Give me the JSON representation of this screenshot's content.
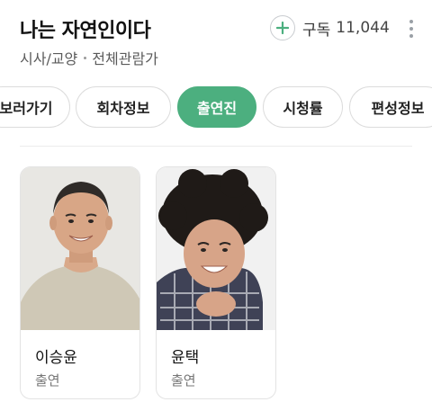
{
  "program": {
    "title": "나는 자연인이다",
    "genre": "시사/교양",
    "rating": "전체관람가"
  },
  "subscribe": {
    "label": "구독",
    "count": "11,044"
  },
  "tabs": [
    {
      "label": "보러가기",
      "active": false
    },
    {
      "label": "회차정보",
      "active": false
    },
    {
      "label": "출연진",
      "active": true
    },
    {
      "label": "시청률",
      "active": false
    },
    {
      "label": "편성정보",
      "active": false
    }
  ],
  "cast": [
    {
      "name": "이승윤",
      "role": "출연"
    },
    {
      "name": "윤택",
      "role": "출연"
    }
  ],
  "colors": {
    "accent_green": "#4caf7f",
    "text_primary": "#111111",
    "text_secondary": "#777777"
  },
  "icons": {
    "subscribe": "plus-circle-icon",
    "more": "more-vertical-icon"
  }
}
